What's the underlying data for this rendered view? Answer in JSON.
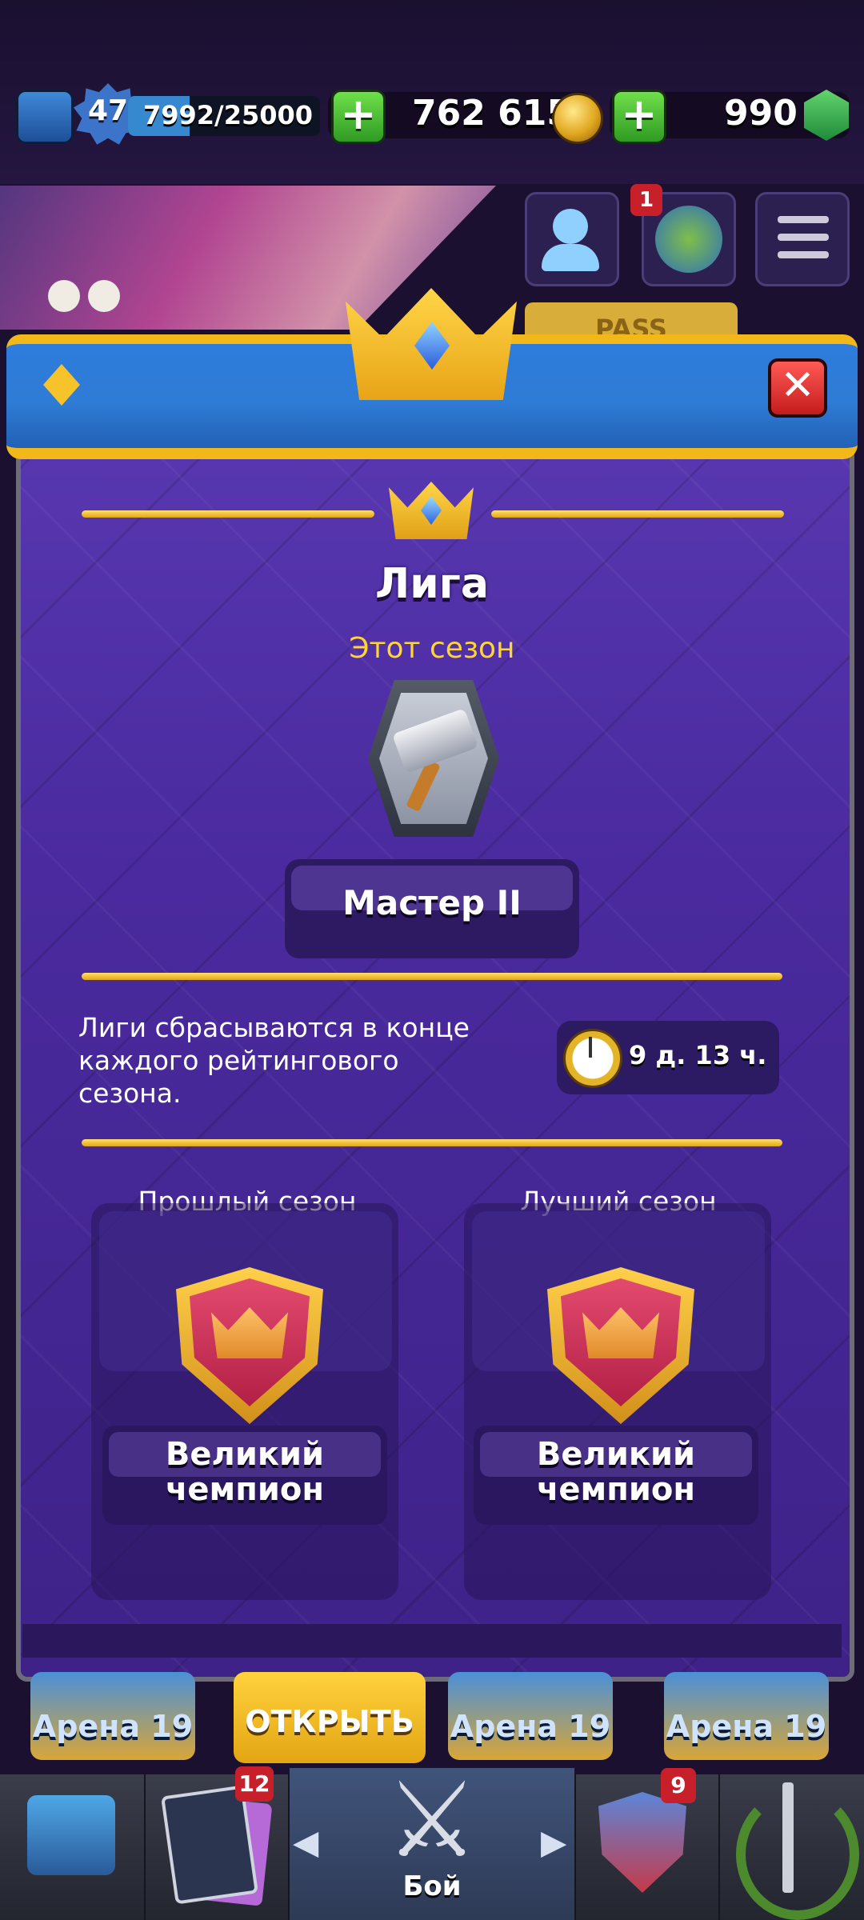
{
  "topbar": {
    "level": "47",
    "xp_text": "7992/25000",
    "xp_progress": 0.32,
    "plus_label": "+",
    "gold": "762 615",
    "gems": "990"
  },
  "header_icons": {
    "notification_count": "1",
    "pass_label": "PASS"
  },
  "modal": {
    "close_label": "✕",
    "title": "Лига",
    "this_season_label": "Этот сезон",
    "current_rank": "Мастер II",
    "info_text": "Лиги сбрасываются в конце каждого рейтингового сезона.",
    "timer": "9 д. 13 ч.",
    "past_season": {
      "label": "Прошлый сезон",
      "rank_line1": "Великий",
      "rank_line2": "чемпион"
    },
    "best_season": {
      "label": "Лучший сезон",
      "rank_line1": "Великий",
      "rank_line2": "чемпион"
    }
  },
  "behind_row": {
    "arena_1": "Арена 19",
    "open_button": "ОТКРЫТЬ",
    "arena_2": "Арена 19",
    "arena_3": "Арена 19"
  },
  "navbar": {
    "cards_badge": "12",
    "clan_badge": "9",
    "battle_label": "Бой",
    "left_arrow": "◀",
    "right_arrow": "▶"
  },
  "colors": {
    "accent_gold": "#f2b718",
    "header_blue": "#2e7cdc",
    "modal_purple": "#4a2a9e",
    "season_yellow": "#ffd534"
  }
}
